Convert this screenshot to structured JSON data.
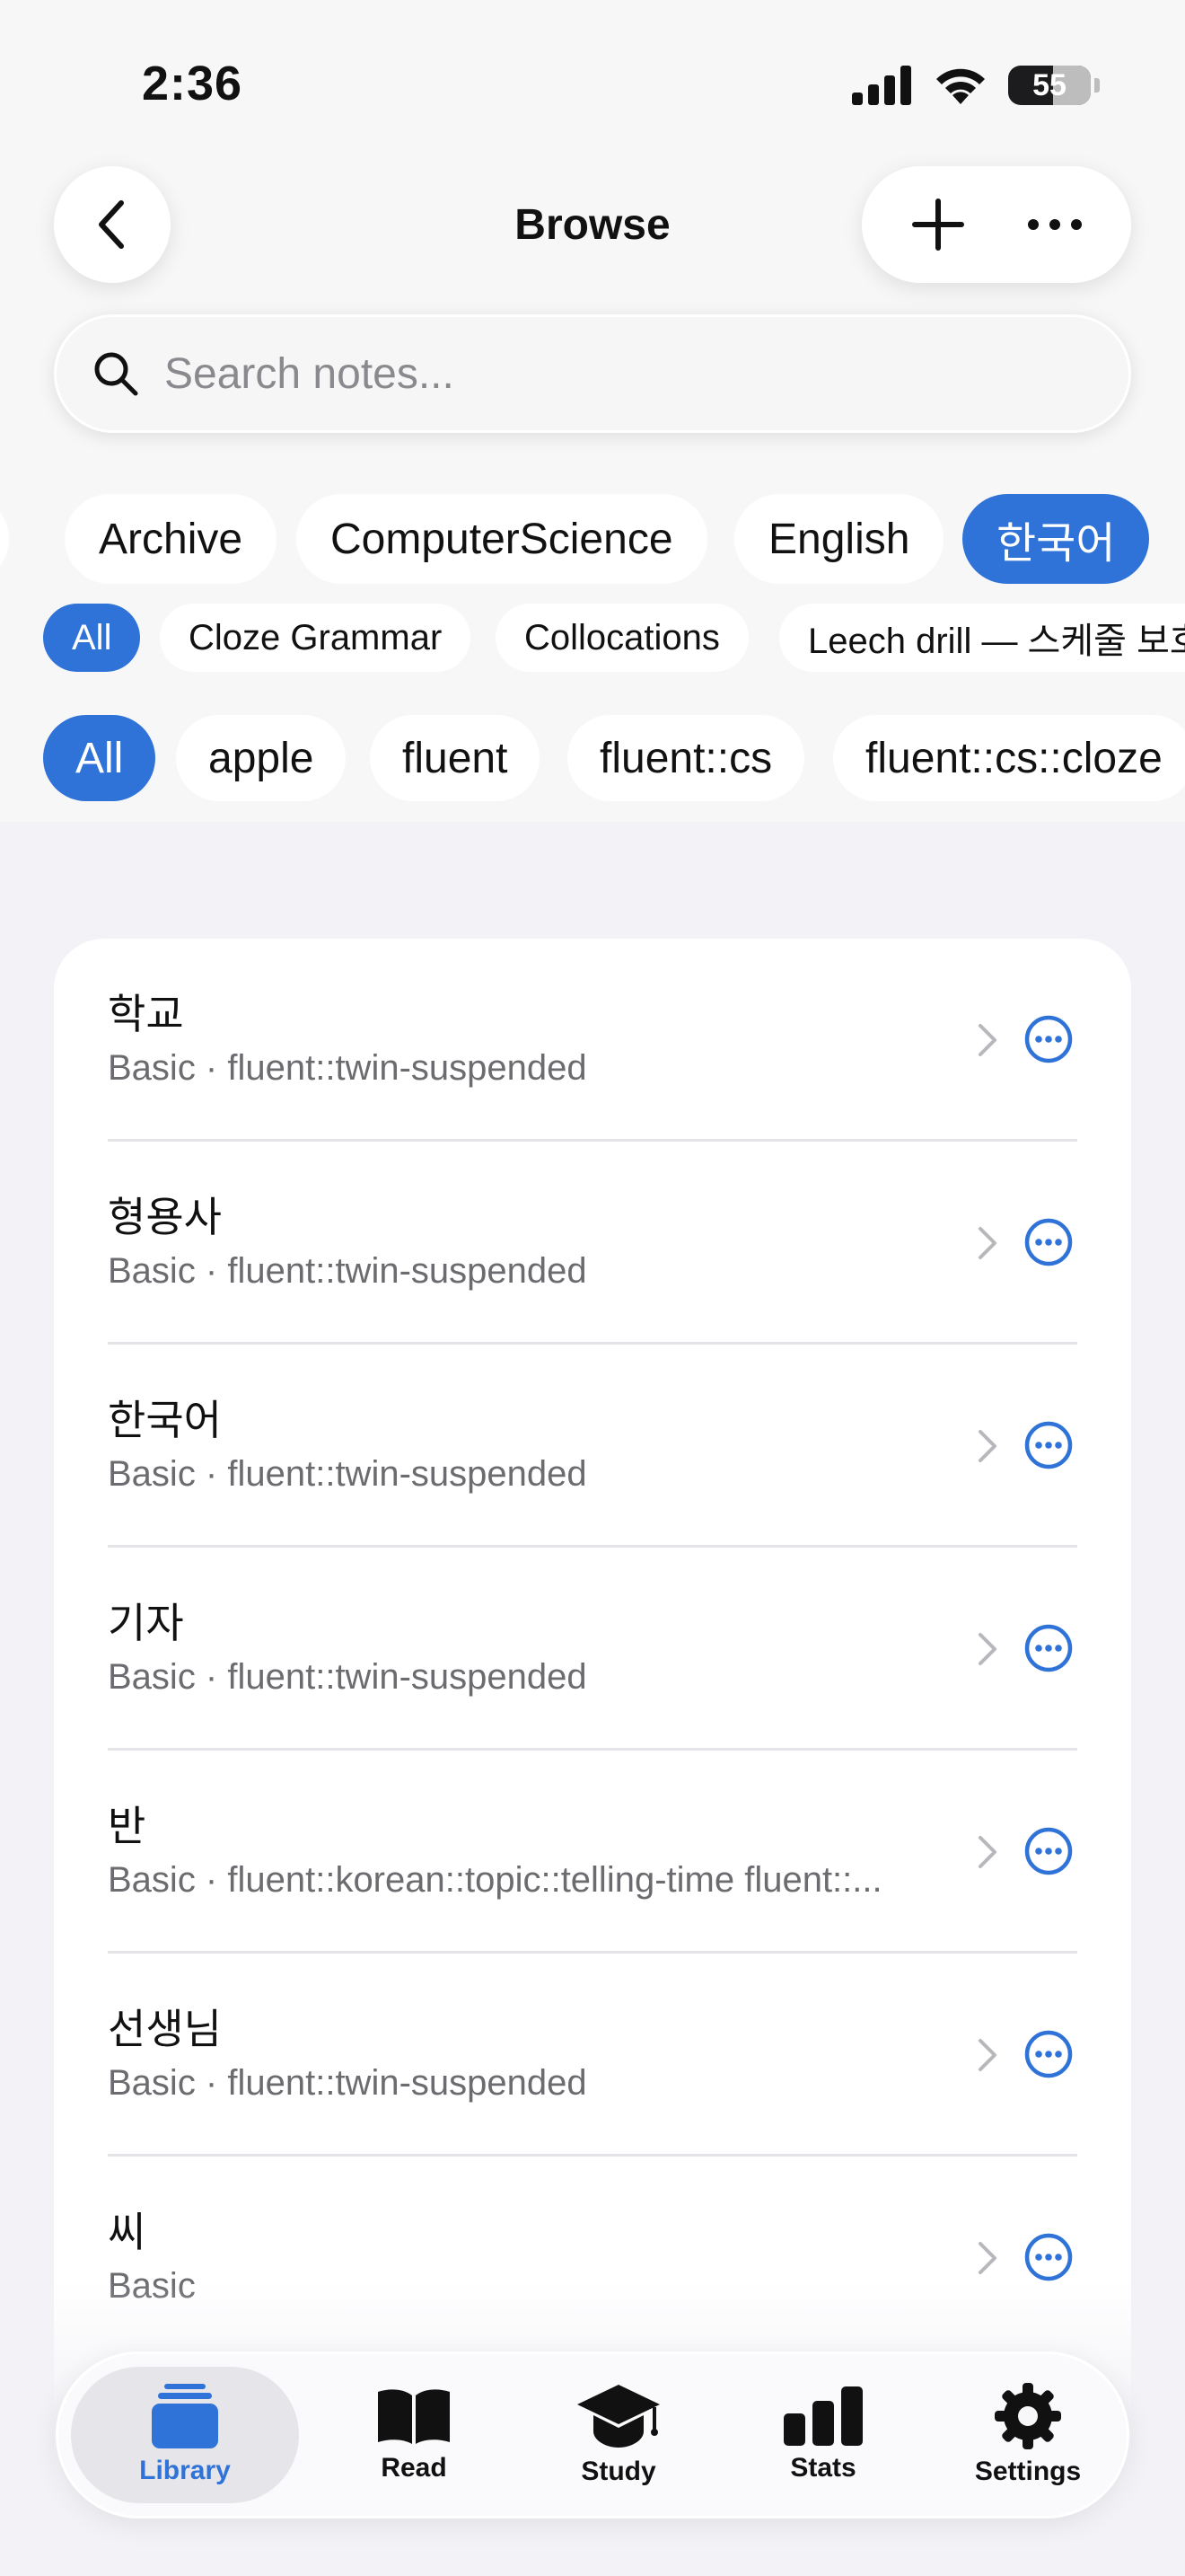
{
  "status_bar": {
    "time": "2:36",
    "battery": "55"
  },
  "header": {
    "title": "Browse"
  },
  "search": {
    "placeholder": "Search notes..."
  },
  "deck_chips": [
    {
      "label": "l",
      "active": false
    },
    {
      "label": "Archive",
      "active": false
    },
    {
      "label": "ComputerScience",
      "active": false
    },
    {
      "label": "English",
      "active": false
    },
    {
      "label": "한국어",
      "active": true
    }
  ],
  "notetype_chips": [
    {
      "label": "All",
      "active": true
    },
    {
      "label": "Cloze Grammar",
      "active": false
    },
    {
      "label": "Collocations",
      "active": false
    },
    {
      "label": "Leech drill — 스케줄 보호",
      "active": false
    }
  ],
  "tag_chips": [
    {
      "label": "All",
      "active": true
    },
    {
      "label": "apple",
      "active": false
    },
    {
      "label": "fluent",
      "active": false
    },
    {
      "label": "fluent::cs",
      "active": false
    },
    {
      "label": "fluent::cs::cloze",
      "active": false
    }
  ],
  "notes": [
    {
      "title": "학교",
      "subtitle": "Basic · fluent::twin-suspended"
    },
    {
      "title": "형용사",
      "subtitle": "Basic · fluent::twin-suspended"
    },
    {
      "title": "한국어",
      "subtitle": "Basic · fluent::twin-suspended"
    },
    {
      "title": "기자",
      "subtitle": "Basic · fluent::twin-suspended"
    },
    {
      "title": "반",
      "subtitle": "Basic · fluent::korean::topic::telling-time fluent::..."
    },
    {
      "title": "선생님",
      "subtitle": "Basic · fluent::twin-suspended"
    },
    {
      "title": "씨",
      "subtitle": "Basic"
    }
  ],
  "tabs": [
    {
      "label": "Library",
      "icon": "library-icon",
      "active": true
    },
    {
      "label": "Read",
      "icon": "book-icon",
      "active": false
    },
    {
      "label": "Study",
      "icon": "graduation-cap-icon",
      "active": false
    },
    {
      "label": "Stats",
      "icon": "bar-chart-icon",
      "active": false
    },
    {
      "label": "Settings",
      "icon": "gear-icon",
      "active": false
    }
  ],
  "colors": {
    "accent": "#2F73D8",
    "background": "#F2F2F7",
    "card": "#FFFFFF",
    "secondary_text": "#6B6B70"
  }
}
